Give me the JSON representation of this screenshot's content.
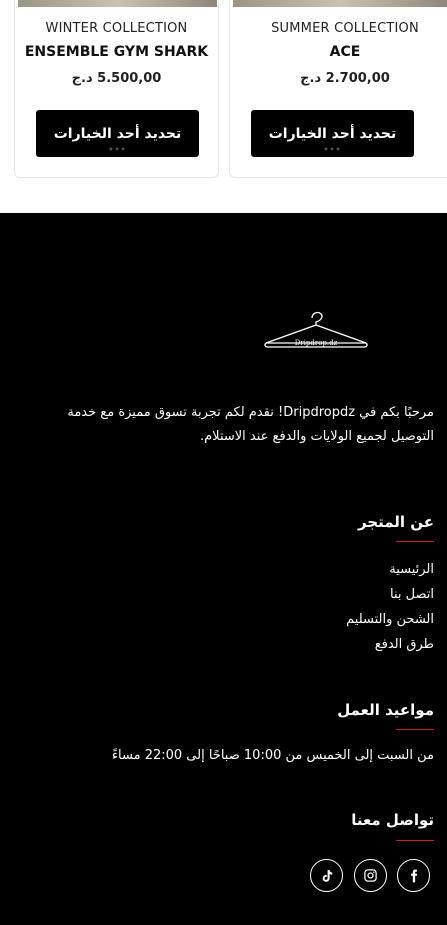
{
  "products": [
    {
      "collection": "WINTER COLLECTION",
      "name": "ENSEMBLE GYM SHARK",
      "price": "5.500,00 د.ج",
      "button": "تحديد أحد الخيارات"
    },
    {
      "collection": "SUMMER COLLECTION",
      "name": "ACE",
      "price": "2.700,00 د.ج",
      "button": "تحديد أحد الخيارات"
    }
  ],
  "footer": {
    "logo_text": "Dripdrop.dz",
    "about": "مرحبًا بكم في Dripdropdz! نقدم لكم تجربة تسوق مميزة مع خدمة التوصيل لجميع الولايات والدفع عند الاستلام.",
    "store_heading": "عن المتجر",
    "store_links": [
      "الرئيسية",
      "اتصل بنا",
      "الشحن والتسليم",
      "طرق الدفع"
    ],
    "hours_heading": "مواعيد العمل",
    "hours_text": "من السبت إلى الخميس من 10:00 صباحًا إلى 22:00 مساءً",
    "contact_heading": "تواصل معنا",
    "social": [
      "facebook-icon",
      "instagram-icon",
      "tiktok-icon"
    ]
  },
  "colors": {
    "accent_rule": "#c81e1e",
    "footer_bg": "#000000",
    "button_bg": "#000000"
  }
}
